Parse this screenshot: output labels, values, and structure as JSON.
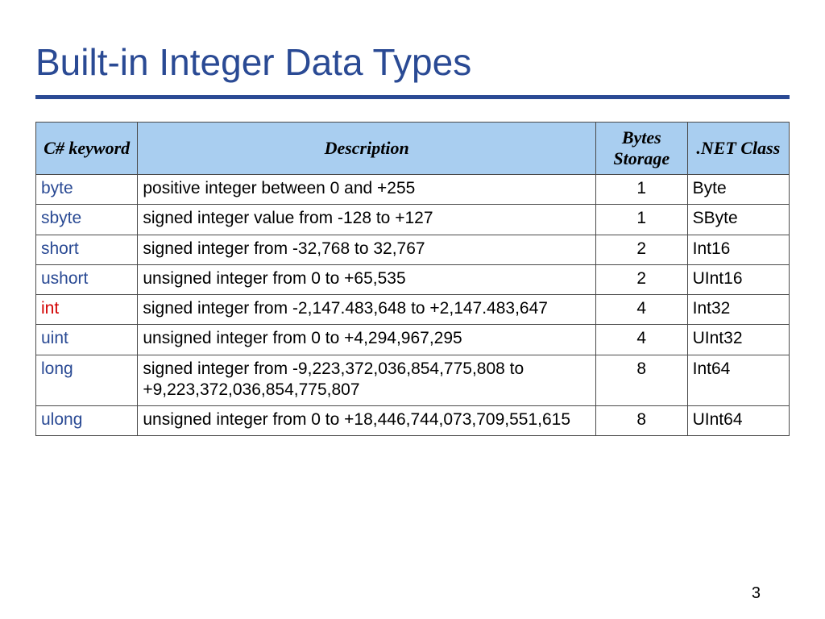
{
  "title": "Built-in Integer Data Types",
  "headers": {
    "keyword": "C# keyword",
    "description": "Description",
    "bytes": "Bytes Storage",
    "netclass": ".NET Class"
  },
  "rows": [
    {
      "keyword": "byte",
      "highlight": false,
      "description": "positive integer between 0 and +255",
      "bytes": "1",
      "netclass": "Byte"
    },
    {
      "keyword": "sbyte",
      "highlight": false,
      "description": "signed integer value from -128 to +127",
      "bytes": "1",
      "netclass": "SByte"
    },
    {
      "keyword": "short",
      "highlight": false,
      "description": "signed integer from -32,768 to 32,767",
      "bytes": "2",
      "netclass": "Int16"
    },
    {
      "keyword": "ushort",
      "highlight": false,
      "description": "unsigned integer from 0 to +65,535",
      "bytes": "2",
      "netclass": "UInt16"
    },
    {
      "keyword": "int",
      "highlight": true,
      "description": "signed integer from -2,147.483,648 to +2,147.483,647",
      "bytes": "4",
      "netclass": "Int32"
    },
    {
      "keyword": "uint",
      "highlight": false,
      "description": "unsigned integer from 0 to +4,294,967,295",
      "bytes": "4",
      "netclass": "UInt32"
    },
    {
      "keyword": "long",
      "highlight": false,
      "description": "signed integer from -9,223,372,036,854,775,808 to +9,223,372,036,854,775,807",
      "bytes": "8",
      "netclass": "Int64"
    },
    {
      "keyword": "ulong",
      "highlight": false,
      "description": "unsigned integer from 0 to +18,446,744,073,709,551,615",
      "bytes": "8",
      "netclass": "UInt64"
    }
  ],
  "page_number": "3"
}
